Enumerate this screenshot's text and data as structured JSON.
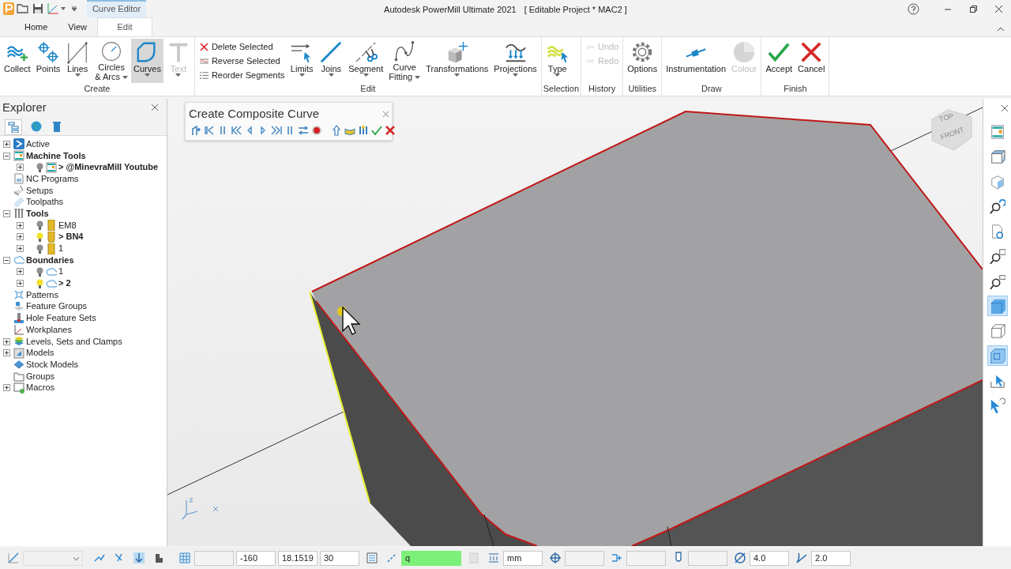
{
  "title_bar": {
    "contextual_tab": "Curve Editor",
    "title": "Autodesk PowerMill Ultimate 2021",
    "project": "[ Editable Project * MAC2 ]"
  },
  "ribbon_tabs": [
    {
      "label": "Home",
      "selected": false
    },
    {
      "label": "View",
      "selected": false
    },
    {
      "label": "Edit",
      "selected": true
    }
  ],
  "ribbon_groups": [
    {
      "label": "Create",
      "items": [
        {
          "kind": "large",
          "label": "Collect",
          "dropdown": false,
          "selected": false,
          "disabled": false
        },
        {
          "kind": "large",
          "label": "Points",
          "dropdown": false,
          "selected": false,
          "disabled": false
        },
        {
          "kind": "large",
          "label": "Lines",
          "dropdown": true,
          "selected": false,
          "disabled": false
        },
        {
          "kind": "large",
          "label": "Circles\n& Arcs",
          "dropdown": true,
          "selected": false,
          "disabled": false
        },
        {
          "kind": "large",
          "label": "Curves",
          "dropdown": true,
          "selected": true,
          "disabled": false
        },
        {
          "kind": "large",
          "label": "Text",
          "dropdown": true,
          "selected": false,
          "disabled": true
        }
      ]
    },
    {
      "label": "Edit",
      "items": [
        {
          "kind": "small",
          "label": "Delete Selected",
          "disabled": false
        },
        {
          "kind": "small",
          "label": "Reverse Selected",
          "disabled": false
        },
        {
          "kind": "small",
          "label": "Reorder Segments",
          "disabled": false
        },
        {
          "kind": "large",
          "label": "Limits",
          "dropdown": true,
          "selected": false,
          "disabled": false
        },
        {
          "kind": "large",
          "label": "Joins",
          "dropdown": true,
          "selected": false,
          "disabled": false
        },
        {
          "kind": "large",
          "label": "Segment",
          "dropdown": true,
          "selected": false,
          "disabled": false
        },
        {
          "kind": "large",
          "label": "Curve\nFitting",
          "dropdown": true,
          "selected": false,
          "disabled": false
        },
        {
          "kind": "large",
          "label": "Transformations",
          "dropdown": true,
          "selected": false,
          "disabled": false
        },
        {
          "kind": "large",
          "label": "Projections",
          "dropdown": true,
          "selected": false,
          "disabled": false
        }
      ]
    },
    {
      "label": "Selection",
      "items": [
        {
          "kind": "large",
          "label": "Type",
          "dropdown": true,
          "selected": false,
          "disabled": false
        }
      ]
    },
    {
      "label": "History",
      "items": [
        {
          "kind": "small",
          "label": "Undo",
          "disabled": true
        },
        {
          "kind": "small",
          "label": "Redo",
          "disabled": true
        }
      ]
    },
    {
      "label": "Utilities",
      "items": [
        {
          "kind": "large",
          "label": "Options",
          "dropdown": false,
          "selected": false,
          "disabled": false
        }
      ]
    },
    {
      "label": "Draw",
      "items": [
        {
          "kind": "large",
          "label": "Instrumentation",
          "dropdown": false,
          "selected": false,
          "disabled": false
        },
        {
          "kind": "large",
          "label": "Colour",
          "dropdown": false,
          "selected": false,
          "disabled": true
        }
      ]
    },
    {
      "label": "Finish",
      "items": [
        {
          "kind": "large",
          "label": "Accept",
          "dropdown": false,
          "selected": false,
          "disabled": false
        },
        {
          "kind": "large",
          "label": "Cancel",
          "dropdown": false,
          "selected": false,
          "disabled": false
        }
      ]
    }
  ],
  "explorer": {
    "title": "Explorer",
    "tree": [
      {
        "label": "Active",
        "bold": false,
        "expanded": false
      },
      {
        "label": "Machine Tools",
        "bold": true,
        "expanded": true,
        "children": [
          {
            "label": "> @MinevraMill Youtube",
            "bold": true,
            "lit": false,
            "expanded": false
          }
        ]
      },
      {
        "label": "NC Programs",
        "bold": false
      },
      {
        "label": "Setups",
        "bold": false
      },
      {
        "label": "Toolpaths",
        "bold": false
      },
      {
        "label": "Tools",
        "bold": true,
        "expanded": true,
        "children": [
          {
            "label": "EM8",
            "bold": false,
            "lit": false,
            "expanded": false
          },
          {
            "label": "> BN4",
            "bold": true,
            "lit": true,
            "expanded": false
          },
          {
            "label": "1",
            "bold": false,
            "lit": false,
            "expanded": false
          }
        ]
      },
      {
        "label": "Boundaries",
        "bold": true,
        "expanded": true,
        "children": [
          {
            "label": "1",
            "bold": false,
            "lit": false,
            "expanded": false
          },
          {
            "label": "> 2",
            "bold": true,
            "lit": true,
            "expanded": false
          }
        ]
      },
      {
        "label": "Patterns",
        "bold": false
      },
      {
        "label": "Feature Groups",
        "bold": false
      },
      {
        "label": "Hole Feature Sets",
        "bold": false
      },
      {
        "label": "Workplanes",
        "bold": false
      },
      {
        "label": "Levels, Sets and Clamps",
        "bold": false,
        "expanded": false
      },
      {
        "label": "Models",
        "bold": false,
        "expanded": false
      },
      {
        "label": "Stock Models",
        "bold": false
      },
      {
        "label": "Groups",
        "bold": false
      },
      {
        "label": "Macros",
        "bold": false,
        "expanded": false
      }
    ]
  },
  "dialog": {
    "title": "Create Composite Curve"
  },
  "view_cube": {
    "top": "TOP",
    "front": "FRONT"
  },
  "view_toolbar": [
    {
      "selected": false
    },
    {
      "selected": false
    },
    {
      "selected": false
    },
    {
      "selected": false
    },
    {
      "selected": false
    },
    {
      "selected": false
    },
    {
      "selected": false
    },
    {
      "selected": true
    },
    {
      "selected": false
    },
    {
      "selected": true
    },
    {
      "selected": false
    },
    {
      "selected": false
    }
  ],
  "status_bar": {
    "fields": [
      {
        "value": "-160",
        "highlighted": false
      },
      {
        "value": "18.1519",
        "highlighted": false
      },
      {
        "value": "30",
        "highlighted": false
      },
      {
        "value": "q",
        "highlighted": true
      },
      {
        "value": "mm",
        "highlighted": false
      },
      {
        "value": "4.0",
        "highlighted": false
      },
      {
        "value": "2.0",
        "highlighted": false
      }
    ]
  }
}
